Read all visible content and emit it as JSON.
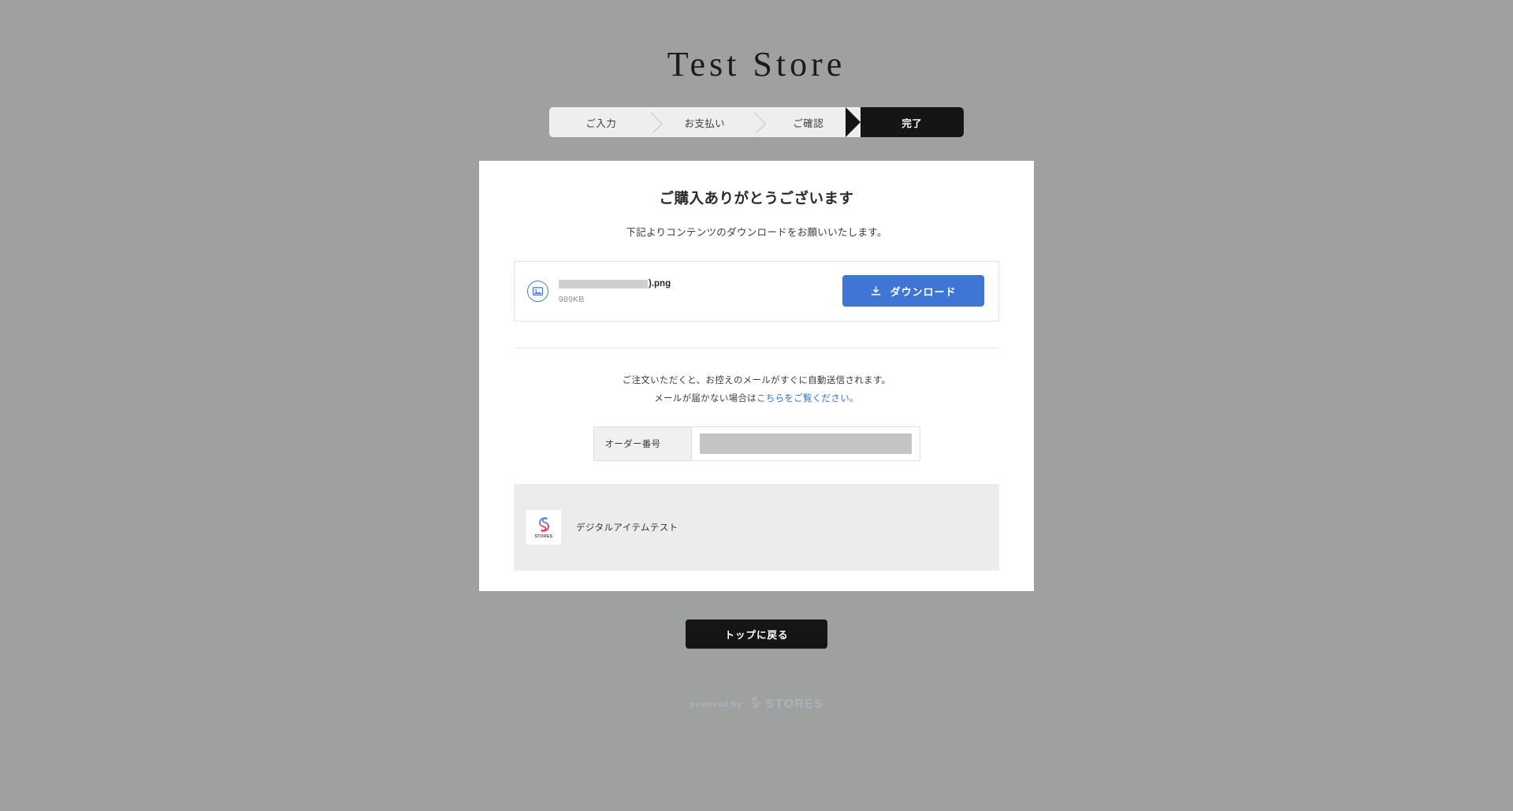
{
  "store": {
    "title": "Test Store"
  },
  "steps": {
    "items": [
      {
        "label": "ご入力",
        "active": false
      },
      {
        "label": "お支払い",
        "active": false
      },
      {
        "label": "ご確認",
        "active": false
      },
      {
        "label": "完了",
        "active": true
      }
    ]
  },
  "card": {
    "heading": "ご購入ありがとうございます",
    "subtitle": "下記よりコンテンツのダウンロードをお願いいたします。",
    "file": {
      "icon": "image-file-icon",
      "name_redacted": true,
      "name_suffix": ").png",
      "size": "989KB",
      "download_button": {
        "label": "ダウンロード",
        "icon": "download-icon",
        "color": "#3f75d4"
      }
    },
    "mail_note": {
      "line1": "ご注文いただくと、お控えのメールがすぐに自動送信されます。",
      "line2_prefix": "メールが届かない場合は",
      "link_text": "こちらをご覧ください。",
      "link_color": "#2f6fd0"
    },
    "order_table": {
      "rows": [
        {
          "label": "オーダー番号",
          "value_redacted": true,
          "value": ""
        }
      ]
    },
    "product": {
      "thumbnail_alt": "stores-logo-icon",
      "thumbnail_caption": "STORES",
      "name": "デジタルアイテムテスト"
    }
  },
  "back_to_top": {
    "label": "トップに戻る"
  },
  "footer": {
    "powered_by": "powered by",
    "brand": "STORES",
    "brand_icon": "stores-logo-icon"
  },
  "colors": {
    "page_background": "#9fa1a1",
    "card_background": "#ffffff",
    "accent_blue": "#3f75d4",
    "active_step": "#151515",
    "product_background": "#ececec"
  }
}
